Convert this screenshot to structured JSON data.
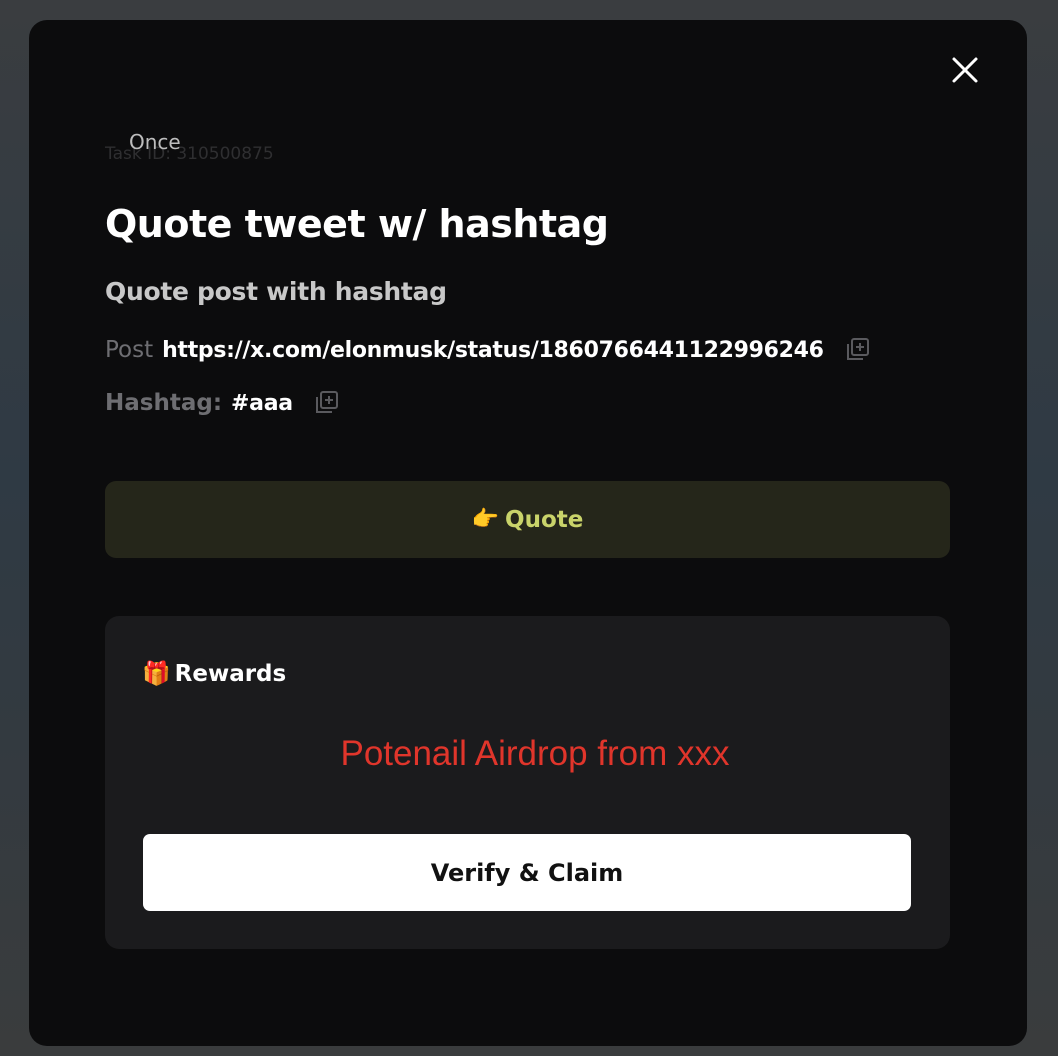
{
  "modal": {
    "close_icon": "close-icon",
    "task_id": "Task ID: 310500875",
    "frequency": "Once",
    "title": "Quote tweet w/ hashtag",
    "subtitle": "Quote post with hashtag",
    "post_label": "Post",
    "post_url": "https://x.com/elonmusk/status/1860766441122996246",
    "hashtag_label": "Hashtag:",
    "hashtag_value": "#aaa",
    "copy_icon": "copy-icon",
    "quote_button": {
      "emoji": "👉",
      "label": "Quote"
    },
    "rewards": {
      "emoji": "🎁",
      "heading": "Rewards",
      "reward_text": "Potenail Airdrop from xxx"
    },
    "claim_button": "Verify & Claim"
  },
  "colors": {
    "modal_bg": "#0c0c0d",
    "quote_btn_bg": "#25261a",
    "quote_btn_text": "#c9d36a",
    "rewards_bg": "#1b1b1d",
    "reward_text": "#e0352b",
    "claim_btn_bg": "#ffffff"
  }
}
